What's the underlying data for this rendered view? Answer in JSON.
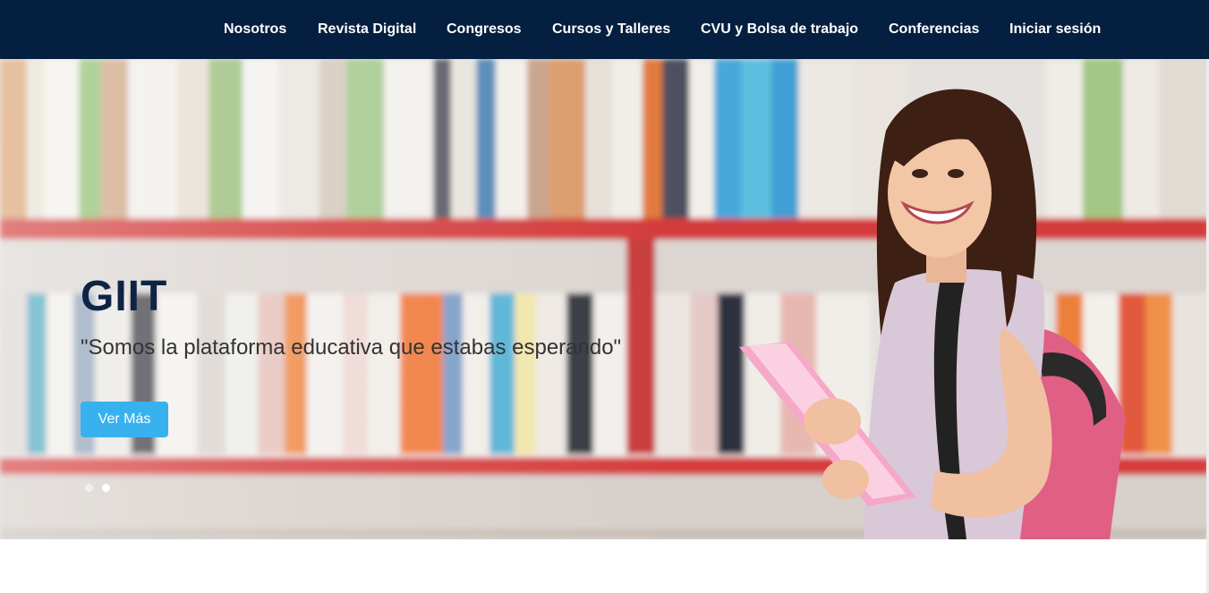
{
  "nav": {
    "items": [
      {
        "label": "Nosotros"
      },
      {
        "label": "Revista Digital"
      },
      {
        "label": "Congresos"
      },
      {
        "label": "Cursos y Talleres"
      },
      {
        "label": "CVU y Bolsa de trabajo"
      },
      {
        "label": "Conferencias"
      },
      {
        "label": "Iniciar sesión"
      }
    ]
  },
  "hero": {
    "title": "GIIT",
    "subtitle": "\"Somos la plataforma educativa que estabas esperando\"",
    "button_label": "Ver Más",
    "carousel": {
      "slide_count": 2,
      "active_slide": 2
    }
  },
  "colors": {
    "navbar": "#041f3f",
    "button": "#38b1ef",
    "title": "#0f2445",
    "shelf": "#d43a3a"
  }
}
